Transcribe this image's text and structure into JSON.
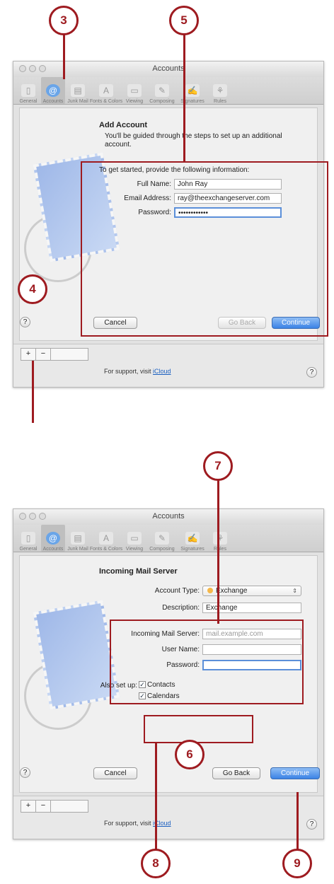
{
  "callouts": {
    "c3": "3",
    "c5": "5",
    "c4": "4",
    "c7": "7",
    "c6": "6",
    "c8": "8",
    "c9": "9"
  },
  "window1": {
    "title": "Accounts",
    "toolbar": [
      "General",
      "Accounts",
      "Junk Mail",
      "Fonts & Colors",
      "Viewing",
      "Composing",
      "Signatures",
      "Rules"
    ],
    "sheet_title": "Add Account",
    "intro": "You'll be guided through the steps to set up an additional account.",
    "prompt": "To get started, provide the following information:",
    "full_name_label": "Full Name:",
    "full_name_value": "John Ray",
    "email_label": "Email Address:",
    "email_value": "ray@theexchangeserver.com",
    "password_label": "Password:",
    "password_value": "••••••••••••",
    "cancel": "Cancel",
    "go_back": "Go Back",
    "continue": "Continue",
    "help": "?",
    "plus": "+",
    "minus": "−",
    "support_prefix": "For support, visit",
    "support_link": "iCloud"
  },
  "window2": {
    "title": "Accounts",
    "toolbar": [
      "General",
      "Accounts",
      "Junk Mail",
      "Fonts & Colors",
      "Viewing",
      "Composing",
      "Signatures",
      "Rules"
    ],
    "sheet_title": "Incoming Mail Server",
    "account_type_label": "Account Type:",
    "account_type_value": "Exchange",
    "description_label": "Description:",
    "description_value": "Exchange",
    "server_label": "Incoming Mail Server:",
    "server_placeholder": "mail.example.com",
    "user_label": "User Name:",
    "password_label": "Password:",
    "also_label": "Also set up:",
    "contacts": "Contacts",
    "calendars": "Calendars",
    "check": "✓",
    "cancel": "Cancel",
    "go_back": "Go Back",
    "continue": "Continue",
    "help": "?",
    "plus": "+",
    "minus": "−",
    "support_prefix": "For support, visit",
    "support_link": "iCloud"
  },
  "colors": {
    "callout": "#9e1b20",
    "accent": "#3b83e6"
  },
  "icons": [
    "general-icon",
    "accounts-icon",
    "junk-mail-icon",
    "fonts-colors-icon",
    "viewing-icon",
    "composing-icon",
    "signatures-icon",
    "rules-icon",
    "help-icon",
    "mail-stamp-icon"
  ]
}
